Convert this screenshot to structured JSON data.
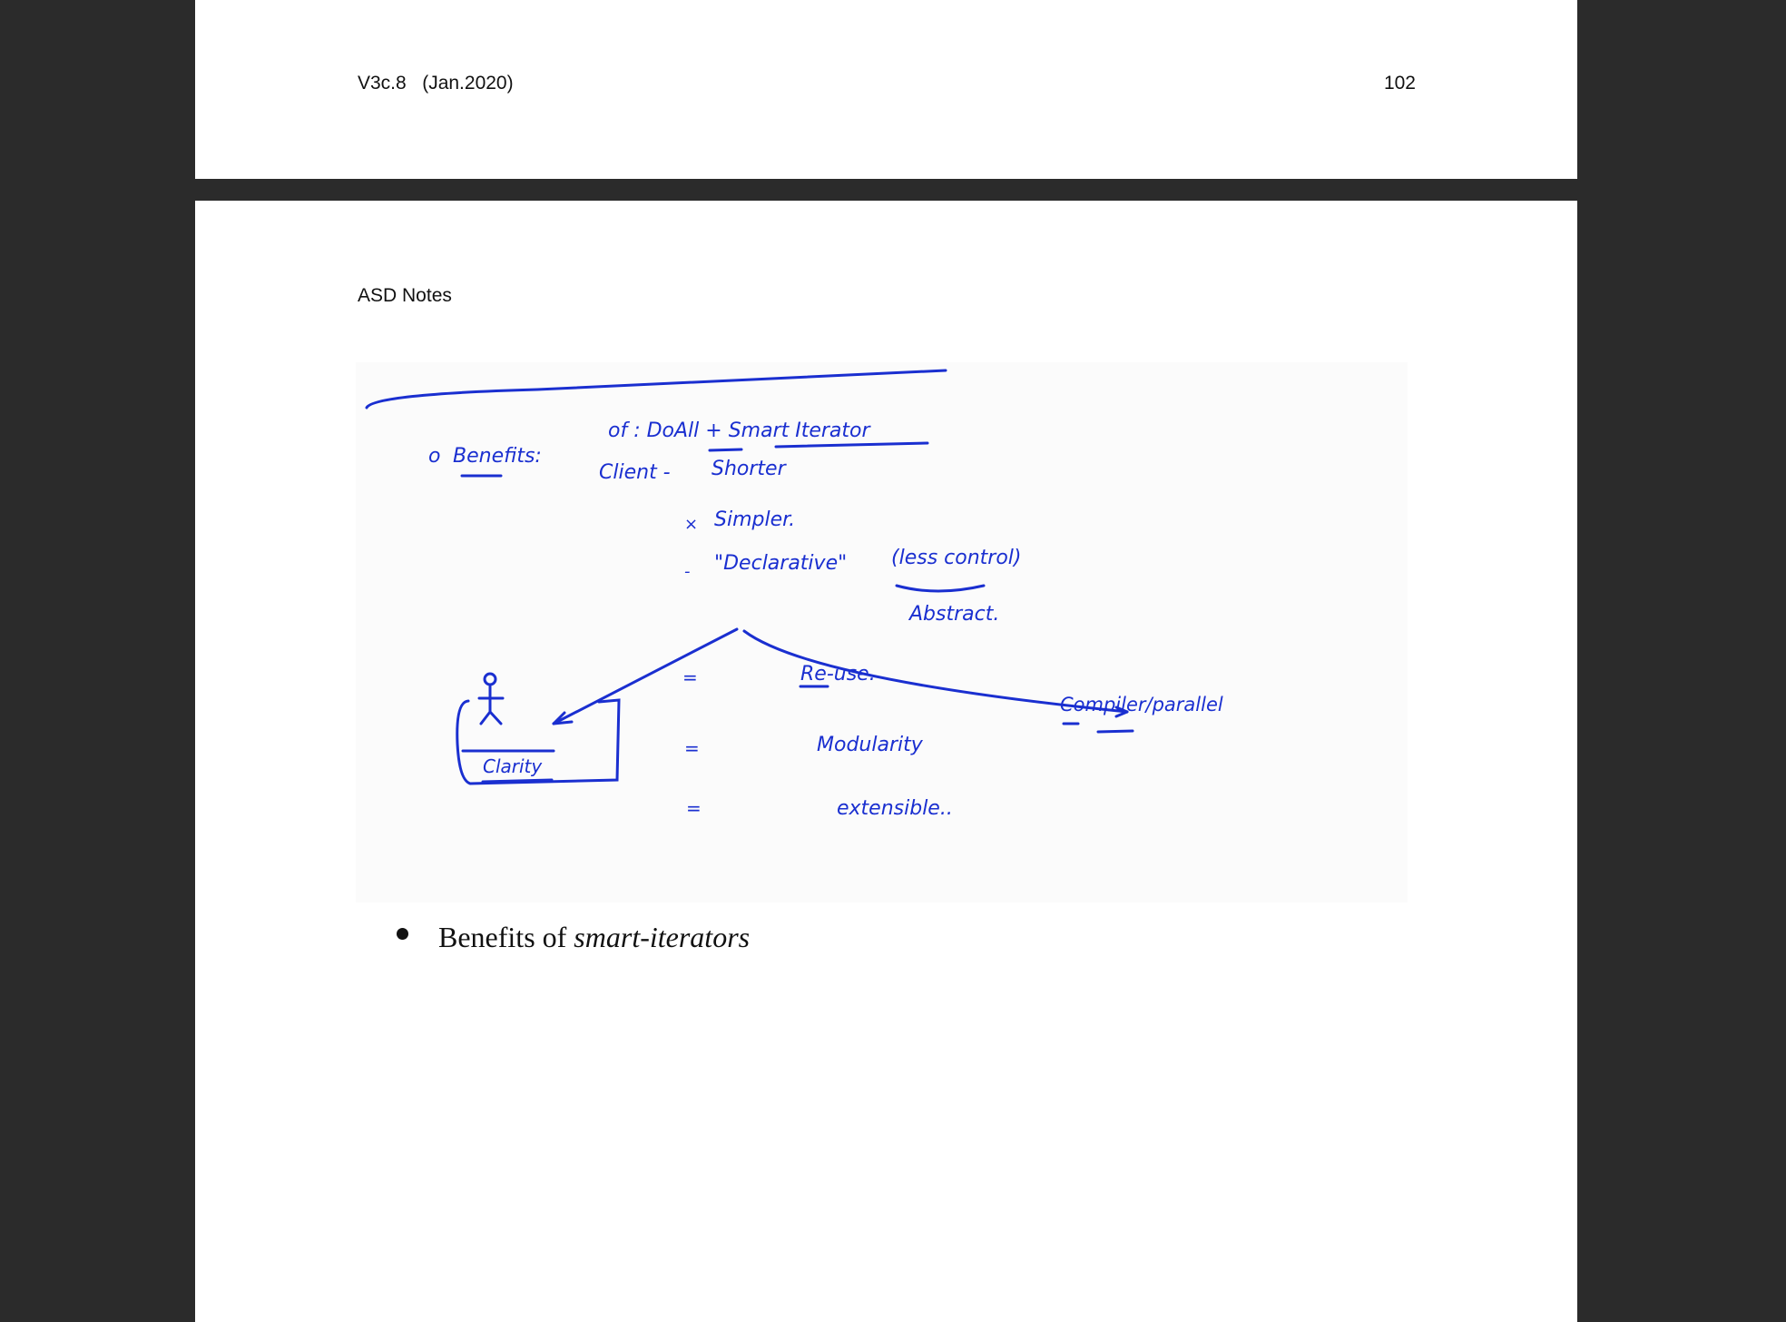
{
  "header": {
    "version": "V3c.8   (Jan.2020)",
    "page_number": "102"
  },
  "doc_title": "ASD Notes",
  "sketch": {
    "benefits_label": "Benefits:",
    "line1": "of : DoAll  +  Smart Iterator",
    "client": "Client -",
    "shorter": "Shorter",
    "simpler": "Simpler.",
    "declarative": "\"Declarative\"",
    "less_control": "(less control)",
    "abstract": "Abstract.",
    "reuse": "Re-use.",
    "modularity": "Modularity",
    "extensible": "extensible..",
    "compiler_parallel": "Compiler/parallel",
    "clarity": "Clarity"
  },
  "bullet": {
    "prefix": "Benefits of ",
    "emphasis": "smart-iterators"
  }
}
